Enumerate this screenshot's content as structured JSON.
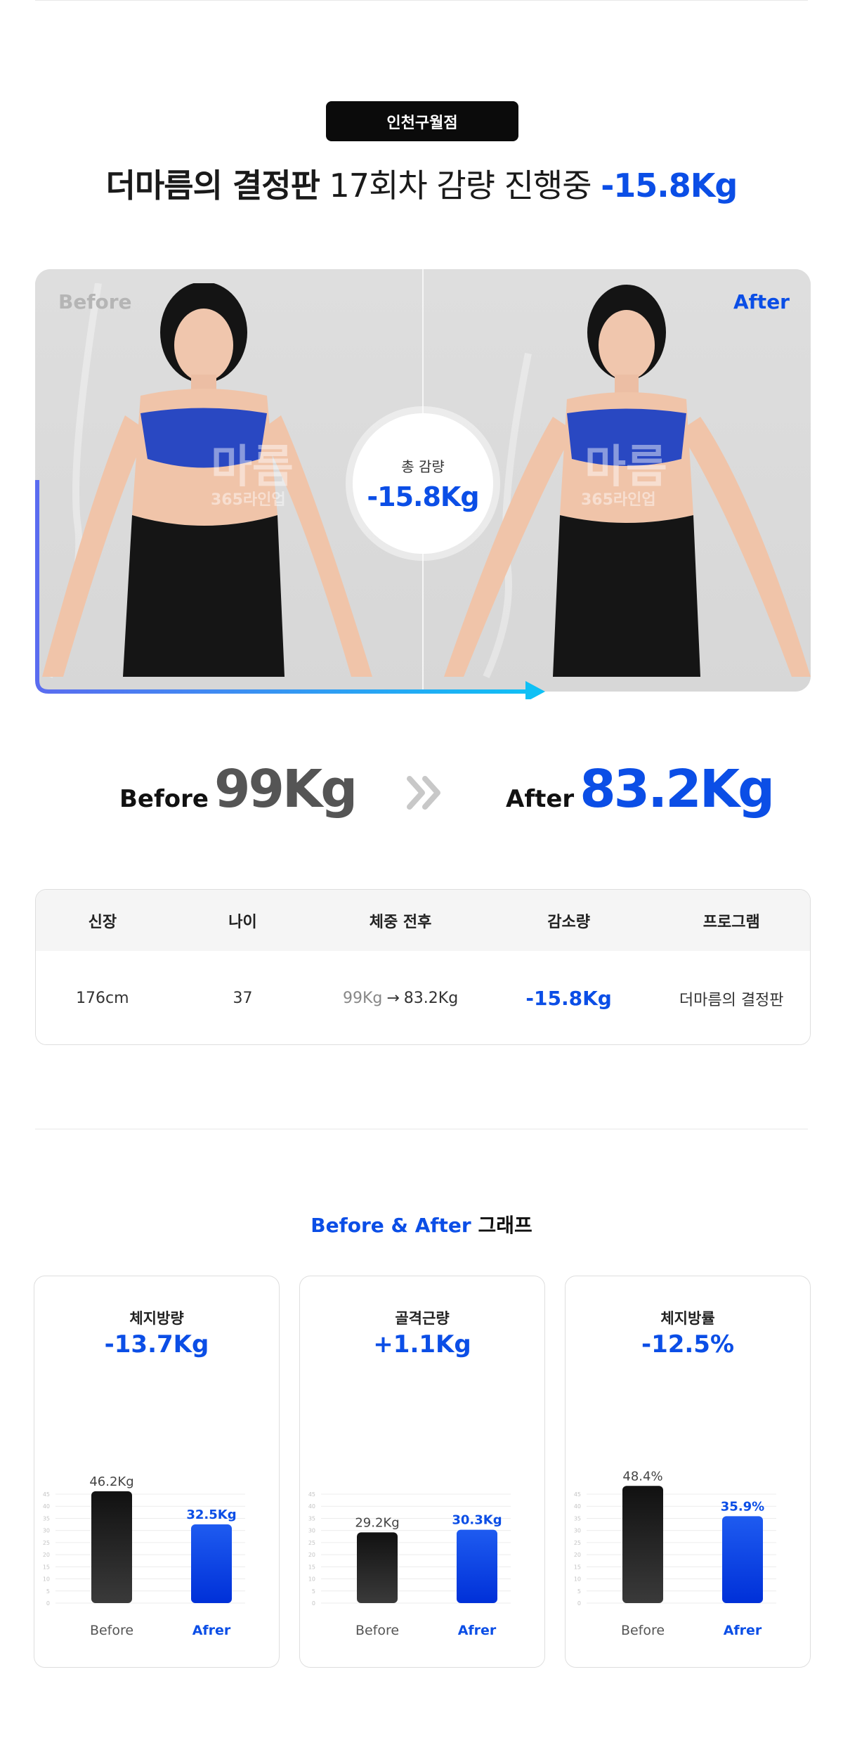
{
  "branch": "인천구월점",
  "headline": {
    "program_bold": "더마름의 결정판",
    "session_text": "17회차 감량 진행중",
    "loss": "-15.8Kg"
  },
  "photo": {
    "before_label": "Before",
    "after_label": "After",
    "total_label": "총 감량",
    "total_value": "-15.8Kg",
    "watermark_main": "마름",
    "watermark_sub": "365라인업"
  },
  "weights": {
    "before_tag": "Before",
    "before_value": "99Kg",
    "after_tag": "After",
    "after_value": "83.2Kg"
  },
  "table": {
    "headers": [
      "신장",
      "나이",
      "체중 전후",
      "감소량",
      "프로그램"
    ],
    "row": {
      "height": "176cm",
      "age": "37",
      "weight_before": "99Kg",
      "arrow": "→",
      "weight_after": "83.2Kg",
      "reduction": "-15.8Kg",
      "program": "더마름의 결정판"
    }
  },
  "graph_section": {
    "title_blue": "Before & After",
    "title_dark": "그래프"
  },
  "chart_data": [
    {
      "type": "bar",
      "title": "체지방량",
      "change": "-13.7Kg",
      "categories": [
        "Before",
        "Afrer"
      ],
      "values": [
        46.2,
        32.5
      ],
      "value_labels": [
        "46.2Kg",
        "32.5Kg"
      ],
      "ylim": [
        0,
        45
      ],
      "yticks": [
        0,
        5,
        10,
        15,
        20,
        25,
        30,
        35,
        40,
        45
      ],
      "grid": true
    },
    {
      "type": "bar",
      "title": "골격근량",
      "change": "+1.1Kg",
      "categories": [
        "Before",
        "Afrer"
      ],
      "values": [
        29.2,
        30.3
      ],
      "value_labels": [
        "29.2Kg",
        "30.3Kg"
      ],
      "ylim": [
        0,
        45
      ],
      "yticks": [
        0,
        5,
        10,
        15,
        20,
        25,
        30,
        35,
        40,
        45
      ],
      "grid": true
    },
    {
      "type": "bar",
      "title": "체지방률",
      "change": "-12.5%",
      "categories": [
        "Before",
        "Afrer"
      ],
      "values": [
        48.4,
        35.9
      ],
      "value_labels": [
        "48.4%",
        "35.9%"
      ],
      "ylim": [
        0,
        45
      ],
      "yticks": [
        0,
        5,
        10,
        15,
        20,
        25,
        30,
        35,
        40,
        45
      ],
      "grid": true
    }
  ],
  "colors": {
    "accent": "#0b4ee6",
    "before_bar": "#1f1f1f",
    "after_bar": "#0038e0",
    "badge_bg": "#0b0b0b"
  }
}
